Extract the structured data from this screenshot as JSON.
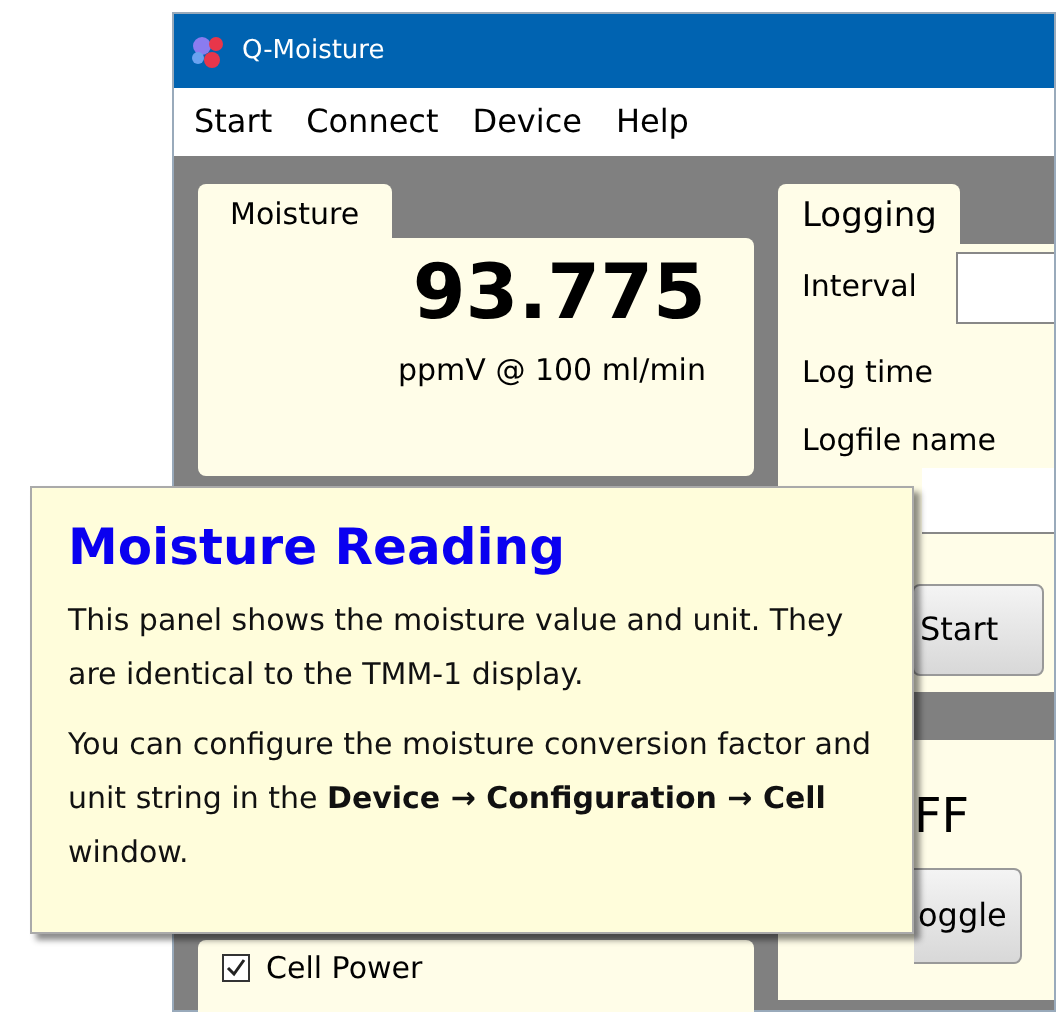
{
  "window": {
    "title": "Q-Moisture"
  },
  "menu": [
    "Start",
    "Connect",
    "Device",
    "Help"
  ],
  "moisture_panel": {
    "title": "Moisture",
    "value": "93.775",
    "unit": "ppmV @ 100 ml/min"
  },
  "logging_panel": {
    "title": "Logging",
    "interval_label": "Interval",
    "log_time_label": "Log time",
    "logfile_label": "Logfile name",
    "start_button": "Start"
  },
  "power_panel": {
    "state": "FF",
    "toggle_button": "oggle"
  },
  "cell_power": {
    "label": "Cell Power",
    "checked": true
  },
  "tooltip": {
    "title": "Moisture Reading",
    "paragraphs": [
      "This panel shows the moisture value and unit. They are identical to the TMM-1 display.",
      "You can configure the moisture conversion factor and unit string in the **Device → Configuration → Cell** window."
    ]
  }
}
